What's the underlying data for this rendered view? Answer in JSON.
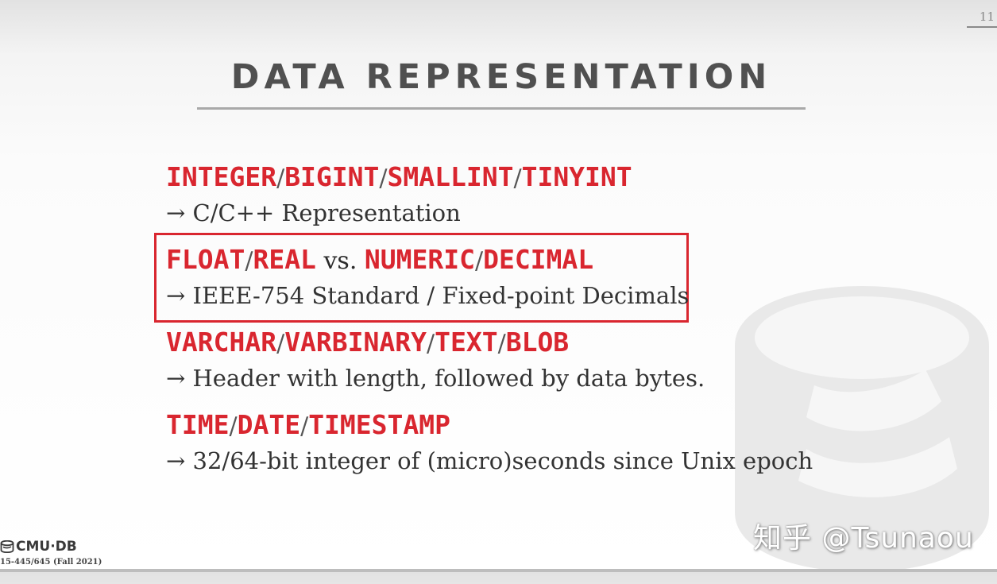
{
  "slide": {
    "number": "11",
    "title": "DATA REPRESENTATION"
  },
  "items": [
    {
      "parts": [
        "INTEGER",
        "/",
        "BIGINT",
        "/",
        "SMALLINT",
        "/",
        "TINYINT"
      ],
      "description": "→ C/C++ Representation"
    },
    {
      "parts": [
        "FLOAT",
        "/",
        "REAL",
        " vs. ",
        "NUMERIC",
        "/",
        "DECIMAL"
      ],
      "description": "→ IEEE-754 Standard / Fixed-point Decimals"
    },
    {
      "parts": [
        "VARCHAR",
        "/",
        "VARBINARY",
        "/",
        "TEXT",
        "/",
        "BLOB"
      ],
      "description": "→ Header with length, followed by data bytes."
    },
    {
      "parts": [
        "TIME",
        "/",
        "DATE",
        "/",
        "TIMESTAMP"
      ],
      "description": "→ 32/64-bit integer of (micro)seconds since Unix epoch"
    }
  ],
  "footer": {
    "logo_text": "CMU·DB",
    "course": "15-445/645 (Fall 2021)"
  },
  "watermark_text": "知乎 @Tsunaou",
  "colors": {
    "accent_red": "#d9262f",
    "title_gray": "#505050",
    "body_text": "#333333"
  }
}
